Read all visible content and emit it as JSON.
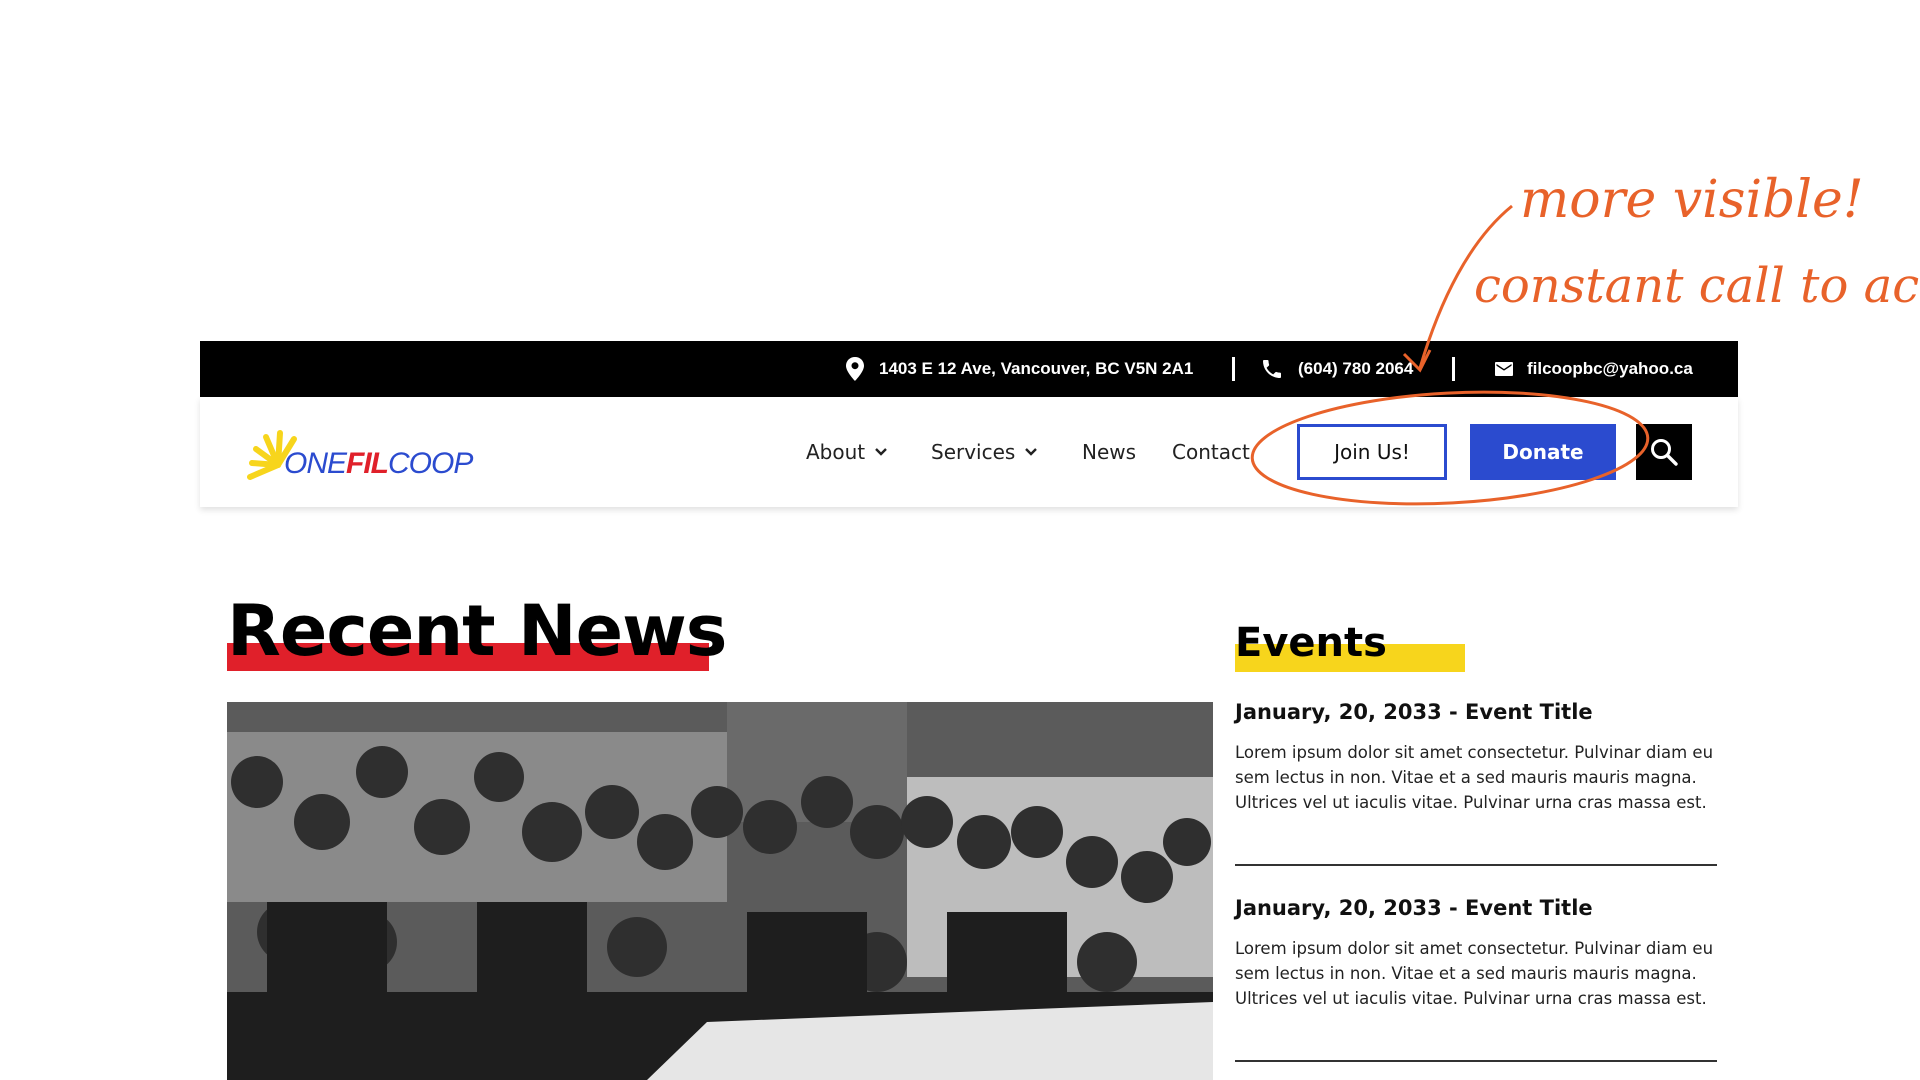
{
  "annotations": {
    "note_1": "more visible!",
    "note_2": "constant call to action"
  },
  "topbar": {
    "address": "1403 E 12 Ave, Vancouver, BC V5N 2A1",
    "phone": "(604) 780 2064",
    "email": "filcoopbc@yahoo.ca"
  },
  "logo": {
    "part_one": "ONE",
    "part_fil": "FIL",
    "part_coop": "COOP"
  },
  "nav": {
    "about": "About",
    "services": "Services",
    "news": "News",
    "contact": "Contact"
  },
  "cta": {
    "join": "Join Us!",
    "donate": "Donate"
  },
  "news": {
    "title": "Recent News"
  },
  "events": {
    "title": "Events",
    "items": [
      {
        "title": "January, 20, 2033 - Event Title",
        "desc": "Lorem ipsum dolor sit amet consectetur. Pulvinar diam eu sem lectus in non. Vitae et a sed mauris mauris magna. Ultrices vel ut iaculis vitae. Pulvinar urna cras massa est."
      },
      {
        "title": "January, 20, 2033 - Event Title",
        "desc": "Lorem ipsum dolor sit amet consectetur. Pulvinar diam eu sem lectus in non. Vitae et a sed mauris mauris magna. Ultrices vel ut iaculis vitae. Pulvinar urna cras massa est."
      }
    ]
  },
  "colors": {
    "accent_blue": "#2b4bcf",
    "accent_red": "#e0202a",
    "accent_yellow": "#f7d51c",
    "annotation_orange": "#e8622a"
  },
  "icons": [
    "location-pin-icon",
    "phone-icon",
    "mail-icon",
    "chevron-down-icon",
    "search-icon"
  ]
}
